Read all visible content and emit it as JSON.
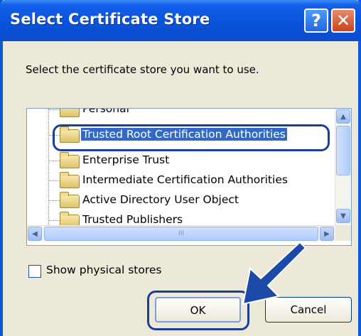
{
  "window": {
    "title": "Select Certificate Store",
    "help_label": "?",
    "close_label": "✕"
  },
  "dialog": {
    "prompt": "Select the certificate store you want to use."
  },
  "tree": {
    "items": [
      {
        "label": "Personal"
      },
      {
        "label": "Trusted Root Certification Authorities",
        "selected": true
      },
      {
        "label": "Enterprise Trust"
      },
      {
        "label": "Intermediate Certification Authorities"
      },
      {
        "label": "Active Directory User Object"
      },
      {
        "label": "Trusted Publishers"
      }
    ],
    "scroll_up": "▲",
    "scroll_down": "▼",
    "scroll_left": "◀",
    "scroll_right": "▶",
    "grip": "III"
  },
  "options": {
    "show_physical_label": "Show physical stores",
    "show_physical_checked": false
  },
  "buttons": {
    "ok_label": "OK",
    "cancel_label": "Cancel"
  },
  "annotations": {
    "arrow_color": "#1b4aa8",
    "highlight_color": "#1b3f95"
  }
}
